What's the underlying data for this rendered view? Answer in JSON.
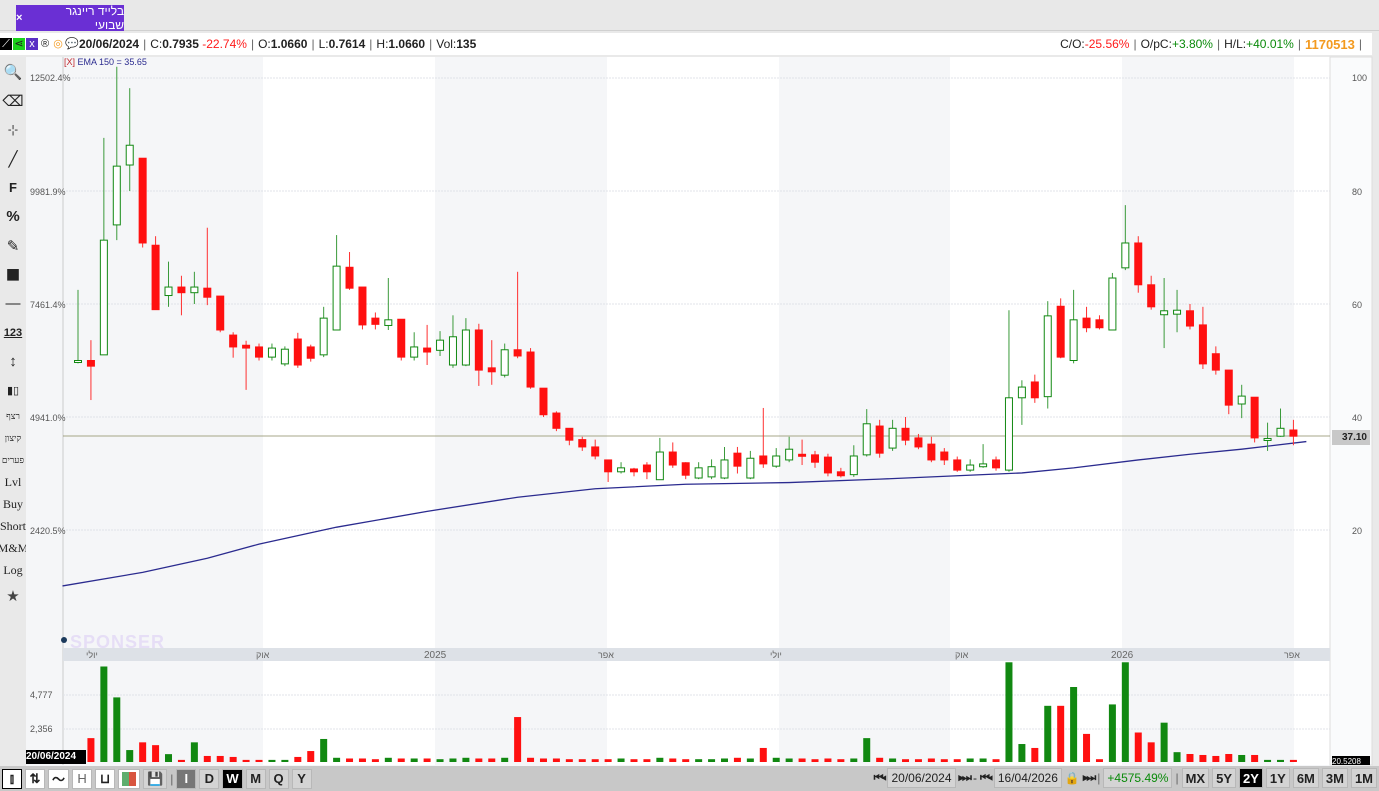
{
  "tab": {
    "title": "בלייד ריינגר שבועי",
    "close": "×"
  },
  "info": {
    "date": "20/06/2024",
    "c_label": "C:",
    "c": "0.7935",
    "c_chg": "-22.74%",
    "o_label": "O:",
    "o": "1.0660",
    "l_label": "L:",
    "l": "0.7614",
    "h_label": "H:",
    "h": "1.0660",
    "vol_label": "Vol:",
    "vol": "135",
    "co_label": "C/O:",
    "co": "-25.56%",
    "opc_label": "O/pC:",
    "opc": "+3.80%",
    "hl_label": "H/L:",
    "hl": "+40.01%",
    "id": "1170513"
  },
  "toolbar": {
    "items": [
      "🔍",
      "⌫",
      "-¦-",
      "╱",
      "F",
      "%",
      "✎",
      "■",
      "—",
      "123",
      "↕",
      "▮▯"
    ],
    "heb": [
      "רצף",
      "קיצון",
      "פערים"
    ],
    "txt": [
      "Lvl",
      "Buy",
      "Short",
      "M&M",
      "Log"
    ],
    "star": "★"
  },
  "indicator": {
    "close_tag": "[X]",
    "label": "EMA 150 = 35.65"
  },
  "left_axis": [
    "12502.4%",
    "9981.9%",
    "7461.4%",
    "4941.0%",
    "2420.5%"
  ],
  "right_axis": [
    "100",
    "80",
    "60",
    "40",
    "20"
  ],
  "volume_axis": [
    "4,777",
    "2,356"
  ],
  "time_labels": [
    "יולי",
    "אוק",
    "2025",
    "אפר",
    "יולי",
    "אוק",
    "2026",
    "אפר"
  ],
  "last_price": "37.10",
  "cursor_date": "20/06/2024",
  "vol_last": "20.5208",
  "watermark": "SPONSER",
  "colors": {
    "up": "#118811",
    "down": "#ff1010",
    "ema": "#2b2b8f",
    "accent": "#6a2fd4"
  },
  "bottom": {
    "chart_types": [
      "candles",
      "bars",
      "line",
      "H",
      "U",
      "colors",
      "save"
    ],
    "intervals": [
      "I",
      "D",
      "W",
      "M",
      "Q",
      "Y"
    ],
    "active_interval": "W",
    "from": "20/06/2024",
    "to": "16/04/2026",
    "range_chg": "+4575.49%",
    "ranges": [
      "MX",
      "5Y",
      "2Y",
      "1Y",
      "6M",
      "3M",
      "1M"
    ],
    "active_range": "2Y"
  },
  "chart_data": {
    "type": "candlestick",
    "ylim": [
      0,
      100
    ],
    "ohlc": [
      [
        49.8,
        62.5,
        49.5,
        50
      ],
      [
        50,
        53.6,
        43,
        49
      ],
      [
        51,
        89.4,
        51,
        71.3
      ],
      [
        74,
        102,
        71.3,
        84.4
      ],
      [
        84.6,
        98.2,
        80,
        88.1
      ],
      [
        85.8,
        85.8,
        70,
        70.8
      ],
      [
        70.4,
        72,
        59,
        59
      ],
      [
        61.5,
        67.5,
        59.5,
        63
      ],
      [
        63,
        65,
        58,
        62
      ],
      [
        62,
        65.7,
        60,
        63
      ],
      [
        62.8,
        73.5,
        59.8,
        61.2
      ],
      [
        61.4,
        61.4,
        55,
        55.4
      ],
      [
        54.5,
        55,
        50.5,
        52.4
      ],
      [
        52.7,
        53.5,
        44.8,
        52.2
      ],
      [
        52.4,
        53,
        50,
        50.6
      ],
      [
        50.6,
        53,
        50,
        52.2
      ],
      [
        49.4,
        52.5,
        49,
        52
      ],
      [
        53.8,
        54.9,
        48.7,
        49.2
      ],
      [
        52.4,
        52.8,
        49.8,
        50.4
      ],
      [
        51,
        59.5,
        50.6,
        57.5
      ],
      [
        55.4,
        72.2,
        55.4,
        66.7
      ],
      [
        66.5,
        69.2,
        62.5,
        62.8
      ],
      [
        63,
        63,
        55.5,
        56.3
      ],
      [
        57.5,
        58.5,
        55.5,
        56.4
      ],
      [
        56.2,
        64.6,
        55.4,
        57.2
      ],
      [
        57.3,
        57.3,
        50,
        50.6
      ],
      [
        50.6,
        55,
        50,
        52.4
      ],
      [
        52.2,
        56.3,
        49.2,
        51.5
      ],
      [
        51.8,
        55.2,
        50.8,
        53.6
      ],
      [
        49.2,
        58,
        48.7,
        54.2
      ],
      [
        49.2,
        57.5,
        49,
        55.4
      ],
      [
        55.4,
        56.5,
        45.5,
        48.3
      ],
      [
        48.7,
        53.6,
        45.7,
        48
      ],
      [
        47.4,
        53,
        47,
        51.9
      ],
      [
        51.9,
        65.7,
        50.4,
        50.8
      ],
      [
        51.5,
        52.2,
        45,
        45.3
      ],
      [
        45.1,
        45.1,
        40,
        40.4
      ],
      [
        40.7,
        41,
        37.5,
        38
      ],
      [
        38,
        38,
        35,
        35.9
      ],
      [
        36,
        36.5,
        34,
        34.7
      ],
      [
        34.7,
        36,
        32.5,
        33.1
      ],
      [
        32.4,
        32.4,
        28.5,
        30.3
      ],
      [
        30.3,
        32,
        30,
        31
      ],
      [
        30.8,
        31,
        29.5,
        30.3
      ],
      [
        31.5,
        32,
        29,
        30.3
      ],
      [
        28.9,
        36.3,
        28.9,
        33.8
      ],
      [
        33.8,
        35.5,
        31,
        31.5
      ],
      [
        31.9,
        32,
        29,
        29.7
      ],
      [
        29.2,
        32,
        29,
        31
      ],
      [
        29.4,
        32.5,
        29,
        31.2
      ],
      [
        29.2,
        34.7,
        29,
        32.4
      ],
      [
        33.6,
        34.7,
        30,
        31.3
      ],
      [
        29.2,
        34,
        29,
        32.7
      ],
      [
        33.1,
        41.6,
        31,
        31.7
      ],
      [
        31.3,
        34.5,
        31,
        33.1
      ],
      [
        32.4,
        36.5,
        32,
        34.3
      ],
      [
        33.4,
        36,
        31.5,
        33.1
      ],
      [
        33.3,
        34,
        31,
        32
      ],
      [
        32.9,
        33.5,
        29.5,
        30.1
      ],
      [
        30.3,
        31,
        29.3,
        29.6
      ],
      [
        29.8,
        35,
        29.4,
        33.1
      ],
      [
        33.3,
        41.4,
        33,
        38.8
      ],
      [
        38.4,
        39.5,
        32.8,
        33.6
      ],
      [
        34.5,
        39.5,
        34,
        38
      ],
      [
        38,
        40,
        35,
        35.9
      ],
      [
        36.3,
        37,
        34.3,
        34.7
      ],
      [
        35.2,
        36.5,
        32,
        32.4
      ],
      [
        33.8,
        34.5,
        31.5,
        32.4
      ],
      [
        32.4,
        33,
        30.3,
        30.6
      ],
      [
        30.6,
        32.5,
        30.3,
        31.5
      ],
      [
        31.2,
        35.2,
        31,
        31.7
      ],
      [
        32.4,
        33,
        30.5,
        31
      ],
      [
        30.6,
        58.9,
        30.3,
        43.4
      ],
      [
        43.4,
        46.5,
        38.6,
        45.3
      ],
      [
        46.2,
        47.5,
        42.5,
        43.4
      ],
      [
        43.6,
        60.5,
        41.5,
        57.9
      ],
      [
        59.6,
        61,
        50.4,
        50.6
      ],
      [
        50,
        62.5,
        49.5,
        57.2
      ],
      [
        57.5,
        59.5,
        55,
        55.8
      ],
      [
        57.2,
        58,
        55.5,
        55.8
      ],
      [
        55.4,
        65.5,
        55.4,
        64.6
      ],
      [
        66.4,
        77.5,
        66,
        70.8
      ],
      [
        70.8,
        72,
        62,
        63.4
      ],
      [
        63.4,
        65,
        59,
        59.5
      ],
      [
        58.1,
        64.6,
        52.2,
        58.8
      ],
      [
        58.2,
        62.5,
        55,
        58.9
      ],
      [
        58.8,
        60,
        55.5,
        56.1
      ],
      [
        56.3,
        59.5,
        48.5,
        49.4
      ],
      [
        51.2,
        52.5,
        47.5,
        48.3
      ],
      [
        48.3,
        48.3,
        40.5,
        42.1
      ],
      [
        42.3,
        45.7,
        39.8,
        43.7
      ],
      [
        43.5,
        43.5,
        35.5,
        36.3
      ],
      [
        35.9,
        39,
        34,
        36.2
      ],
      [
        36.6,
        41.5,
        36.5,
        38
      ],
      [
        37.7,
        39.5,
        35,
        36.6
      ]
    ],
    "volume": [
      100,
      1700,
      6800,
      4600,
      850,
      1400,
      1200,
      560,
      150,
      1400,
      430,
      430,
      360,
      150,
      150,
      150,
      150,
      360,
      780,
      1640,
      300,
      250,
      250,
      200,
      300,
      250,
      250,
      250,
      200,
      250,
      300,
      250,
      250,
      300,
      3200,
      300,
      250,
      250,
      200,
      200,
      200,
      200,
      250,
      200,
      200,
      300,
      250,
      200,
      200,
      200,
      250,
      300,
      250,
      1000,
      300,
      250,
      250,
      200,
      250,
      200,
      250,
      1700,
      300,
      250,
      200,
      200,
      250,
      200,
      200,
      250,
      250,
      200,
      7100,
      1280,
      1000,
      4000,
      4000,
      5340,
      2000,
      200,
      4100,
      7100,
      2100,
      1400,
      2800,
      700,
      570,
      500,
      430,
      570,
      500,
      500,
      150,
      150,
      150
    ],
    "ema": [
      [
        -1.2,
        10.1
      ],
      [
        5,
        12.5
      ],
      [
        10,
        15
      ],
      [
        14,
        17.5
      ],
      [
        20,
        20.5
      ],
      [
        27,
        23.3
      ],
      [
        34,
        25.8
      ],
      [
        40,
        27.3
      ],
      [
        47,
        28.1
      ],
      [
        55,
        28.4
      ],
      [
        62,
        29
      ],
      [
        68,
        29.6
      ],
      [
        73,
        30.1
      ],
      [
        77,
        31
      ],
      [
        82,
        32.4
      ],
      [
        86,
        33.4
      ],
      [
        90,
        34.3
      ],
      [
        95,
        35.65
      ]
    ]
  }
}
